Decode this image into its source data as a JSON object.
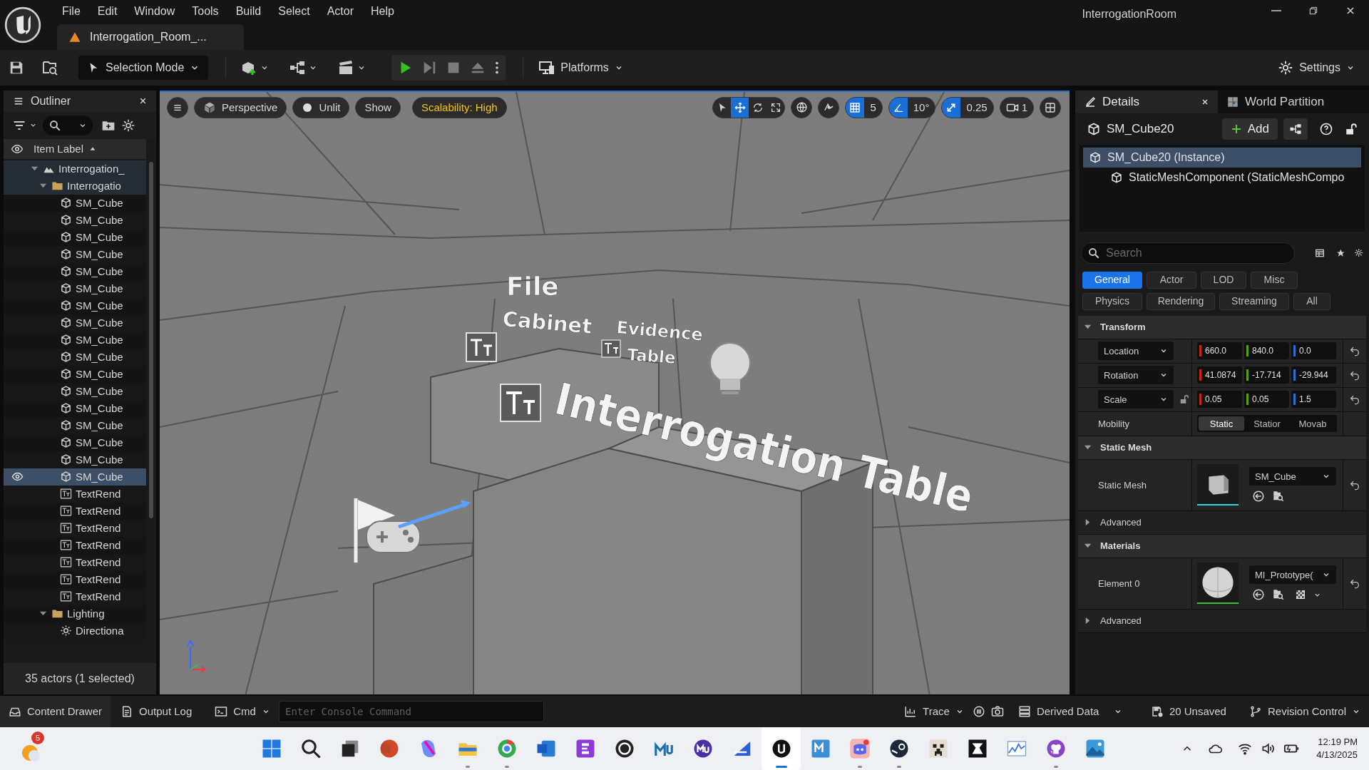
{
  "title_bar": {
    "menus": [
      "File",
      "Edit",
      "Window",
      "Tools",
      "Build",
      "Select",
      "Actor",
      "Help"
    ],
    "document_tab": "Interrogation_Room_...",
    "project": "InterrogationRoom"
  },
  "toolbar": {
    "selection_mode": "Selection Mode",
    "platforms": "Platforms",
    "settings": "Settings"
  },
  "outliner": {
    "title": "Outliner",
    "column": "Item Label",
    "footer": "35 actors (1 selected)",
    "items": [
      {
        "kind": "level",
        "label": "Interrogation_",
        "selected": false,
        "expanded": true,
        "children": [
          {
            "kind": "folder",
            "label": "Interrogatio",
            "selected": false,
            "expanded": true,
            "children": [
              {
                "kind": "mesh",
                "label": "SM_Cube",
                "selected": false
              },
              {
                "kind": "mesh",
                "label": "SM_Cube",
                "selected": false
              },
              {
                "kind": "mesh",
                "label": "SM_Cube",
                "selected": false
              },
              {
                "kind": "mesh",
                "label": "SM_Cube",
                "selected": false
              },
              {
                "kind": "mesh",
                "label": "SM_Cube",
                "selected": false
              },
              {
                "kind": "mesh",
                "label": "SM_Cube",
                "selected": false
              },
              {
                "kind": "mesh",
                "label": "SM_Cube",
                "selected": false
              },
              {
                "kind": "mesh",
                "label": "SM_Cube",
                "selected": false
              },
              {
                "kind": "mesh",
                "label": "SM_Cube",
                "selected": false
              },
              {
                "kind": "mesh",
                "label": "SM_Cube",
                "selected": false
              },
              {
                "kind": "mesh",
                "label": "SM_Cube",
                "selected": false
              },
              {
                "kind": "mesh",
                "label": "SM_Cube",
                "selected": false
              },
              {
                "kind": "mesh",
                "label": "SM_Cube",
                "selected": false
              },
              {
                "kind": "mesh",
                "label": "SM_Cube",
                "selected": false
              },
              {
                "kind": "mesh",
                "label": "SM_Cube",
                "selected": false
              },
              {
                "kind": "mesh",
                "label": "SM_Cube",
                "selected": false
              },
              {
                "kind": "mesh",
                "label": "SM_Cube",
                "selected": true
              },
              {
                "kind": "text",
                "label": "TextRend",
                "selected": false
              },
              {
                "kind": "text",
                "label": "TextRend",
                "selected": false
              },
              {
                "kind": "text",
                "label": "TextRend",
                "selected": false
              },
              {
                "kind": "text",
                "label": "TextRend",
                "selected": false
              },
              {
                "kind": "text",
                "label": "TextRend",
                "selected": false
              },
              {
                "kind": "text",
                "label": "TextRend",
                "selected": false
              },
              {
                "kind": "text",
                "label": "TextRend",
                "selected": false
              }
            ]
          },
          {
            "kind": "folder",
            "label": "Lighting",
            "selected": false,
            "expanded": true,
            "children": [
              {
                "kind": "light",
                "label": "Directiona",
                "selected": false
              }
            ]
          }
        ]
      }
    ]
  },
  "viewport": {
    "view_mode": "Perspective",
    "lighting": "Unlit",
    "show": "Show",
    "scalability": "Scalability: High",
    "tools": [
      {
        "kind": "select",
        "selected": false
      },
      {
        "kind": "move",
        "selected": true
      },
      {
        "kind": "rotate",
        "selected": false
      },
      {
        "kind": "scale",
        "selected": false
      }
    ],
    "snaps": [
      {
        "kind": "grid",
        "label": "5",
        "on": true
      },
      {
        "kind": "angle",
        "label": "10°",
        "on": true
      },
      {
        "kind": "scale",
        "label": "0.25",
        "on": true
      }
    ],
    "camera_speed": "1",
    "scene_labels": [
      "File",
      "Cabinet",
      "Evidence",
      "Table",
      "Interrogation Table"
    ]
  },
  "details": {
    "tabs": [
      {
        "label": "Details",
        "selected": true
      },
      {
        "label": "World Partition",
        "selected": false
      }
    ],
    "actor": "SM_Cube20",
    "add": "Add",
    "components": [
      {
        "label": "SM_Cube20 (Instance)",
        "selected": true,
        "children": [
          {
            "label": "StaticMeshComponent (StaticMeshCompo",
            "selected": false
          }
        ]
      }
    ],
    "search": {
      "placeholder": "Search"
    },
    "filters": [
      {
        "label": "General",
        "selected": true
      },
      {
        "label": "Actor",
        "selected": false
      },
      {
        "label": "LOD",
        "selected": false
      },
      {
        "label": "Misc",
        "selected": false
      },
      {
        "label": "Physics",
        "selected": false
      },
      {
        "label": "Rendering",
        "selected": false
      },
      {
        "label": "Streaming",
        "selected": false
      },
      {
        "label": "All",
        "selected": false
      }
    ],
    "sections": [
      {
        "kind": "category",
        "title": "Transform",
        "expanded": true,
        "rows": [
          {
            "kind": "vector",
            "label": "Location",
            "values": [
              "660.0",
              "840.0",
              "0.0"
            ]
          },
          {
            "kind": "vector",
            "label": "Rotation",
            "values": [
              "41.0874",
              "-17.714",
              "-29.944"
            ]
          },
          {
            "kind": "vector",
            "label": "Scale",
            "locked": false,
            "values": [
              "0.05",
              "0.05",
              "1.5"
            ]
          },
          {
            "kind": "segmented",
            "label": "Mobility",
            "options": [
              {
                "label": "Static",
                "selected": true
              },
              {
                "label": "Statior",
                "selected": false
              },
              {
                "label": "Movab",
                "selected": false
              }
            ]
          }
        ]
      },
      {
        "kind": "category",
        "title": "Static Mesh",
        "expanded": true,
        "rows": [
          {
            "kind": "mesh_asset",
            "label": "Static Mesh",
            "asset": "SM_Cube"
          }
        ]
      },
      {
        "kind": "subgroup",
        "title": "Advanced",
        "expanded": false
      },
      {
        "kind": "category",
        "title": "Materials",
        "expanded": true,
        "rows": [
          {
            "kind": "material_asset",
            "label": "Element 0",
            "asset": "MI_Prototype("
          }
        ]
      },
      {
        "kind": "subgroup",
        "title": "Advanced",
        "expanded": false
      }
    ]
  },
  "bottom_bar": {
    "content_drawer": "Content Drawer",
    "output_log": "Output Log",
    "cmd": "Cmd",
    "console": {
      "placeholder": "Enter Console Command"
    },
    "trace": "Trace",
    "derived_data": "Derived Data",
    "unsaved": "20 Unsaved",
    "revision_control": "Revision Control"
  },
  "taskbar": {
    "notification_badge": "5",
    "apps": [
      {
        "running": false,
        "selected": false
      },
      {
        "running": false,
        "selected": false
      },
      {
        "running": false,
        "selected": false
      },
      {
        "running": false,
        "selected": false
      },
      {
        "running": false,
        "selected": false
      },
      {
        "running": true,
        "selected": false
      },
      {
        "running": true,
        "selected": false
      },
      {
        "running": false,
        "selected": false
      },
      {
        "running": false,
        "selected": false
      },
      {
        "running": false,
        "selected": false
      },
      {
        "running": false,
        "selected": false
      },
      {
        "running": false,
        "selected": false
      },
      {
        "running": false,
        "selected": false
      },
      {
        "running": true,
        "selected": true
      },
      {
        "running": false,
        "selected": false
      },
      {
        "running": true,
        "selected": false
      },
      {
        "running": true,
        "selected": false
      },
      {
        "running": false,
        "selected": false
      },
      {
        "running": false,
        "selected": false
      },
      {
        "running": false,
        "selected": false
      },
      {
        "running": true,
        "selected": false
      },
      {
        "running": false,
        "selected": false
      }
    ],
    "clock": {
      "time": "12:19 PM",
      "date": "4/13/2025"
    }
  }
}
